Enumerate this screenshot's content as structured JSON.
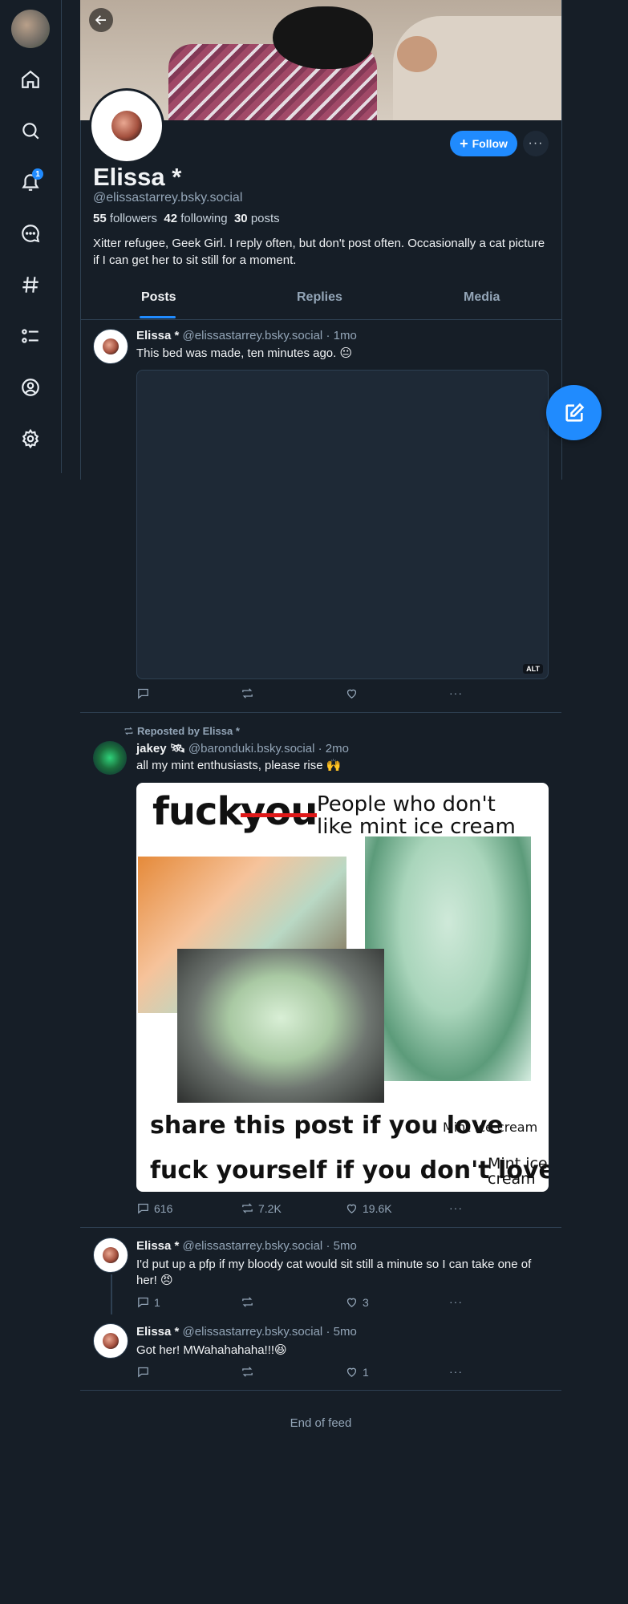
{
  "nav": {
    "notification_count": "1"
  },
  "profile": {
    "display_name": "Elissa *",
    "handle": "@elissastarrey.bsky.social",
    "followers_count": "55",
    "followers_label": "followers",
    "following_count": "42",
    "following_label": "following",
    "posts_count": "30",
    "posts_label": "posts",
    "bio": "Xitter refugee, Geek Girl.  I reply often, but don't post often.  Occasionally a cat picture if I can get her to sit still for a moment.",
    "follow_label": "Follow"
  },
  "tabs": [
    "Posts",
    "Replies",
    "Media"
  ],
  "posts": [
    {
      "author": "Elissa *",
      "handle": "@elissastarrey.bsky.social",
      "time": "· 1mo",
      "text": "This bed was made, ten minutes ago.  😐",
      "alt": "ALT"
    },
    {
      "repost_label": "Reposted by Elissa *",
      "author": "jakey 🛰",
      "handle": "@baronduki.bsky.social",
      "time": "· 2mo",
      "text": "all my mint enthusiasts, please rise 🙌",
      "meme": {
        "line1_a": "fuck",
        "line1_b": "you",
        "line1_c": "People who don't",
        "line1_d": "like mint ice cream",
        "line2_a": "share this post if you love",
        "line2_b": "Mint ice cream",
        "line3_a": "fuck yourself if you don't love",
        "line3_b": "Mint ice",
        "line3_c": "cream"
      },
      "replies": "616",
      "reposts": "7.2K",
      "likes": "19.6K"
    },
    {
      "author": "Elissa *",
      "handle": "@elissastarrey.bsky.social",
      "time": "· 5mo",
      "text": "I'd put up a pfp if my bloody cat would sit still a minute so I can take one of her! 😠",
      "replies": "1",
      "likes": "3"
    },
    {
      "author": "Elissa *",
      "handle": "@elissastarrey.bsky.social",
      "time": "· 5mo",
      "text": "Got her! MWahahahaha!!!😆",
      "likes": "1"
    }
  ],
  "end_of_feed": "End of feed",
  "colors": {
    "background": "#161e27",
    "accent": "#208bfe",
    "border": "#2e4052",
    "muted_text": "#93a5b7"
  }
}
